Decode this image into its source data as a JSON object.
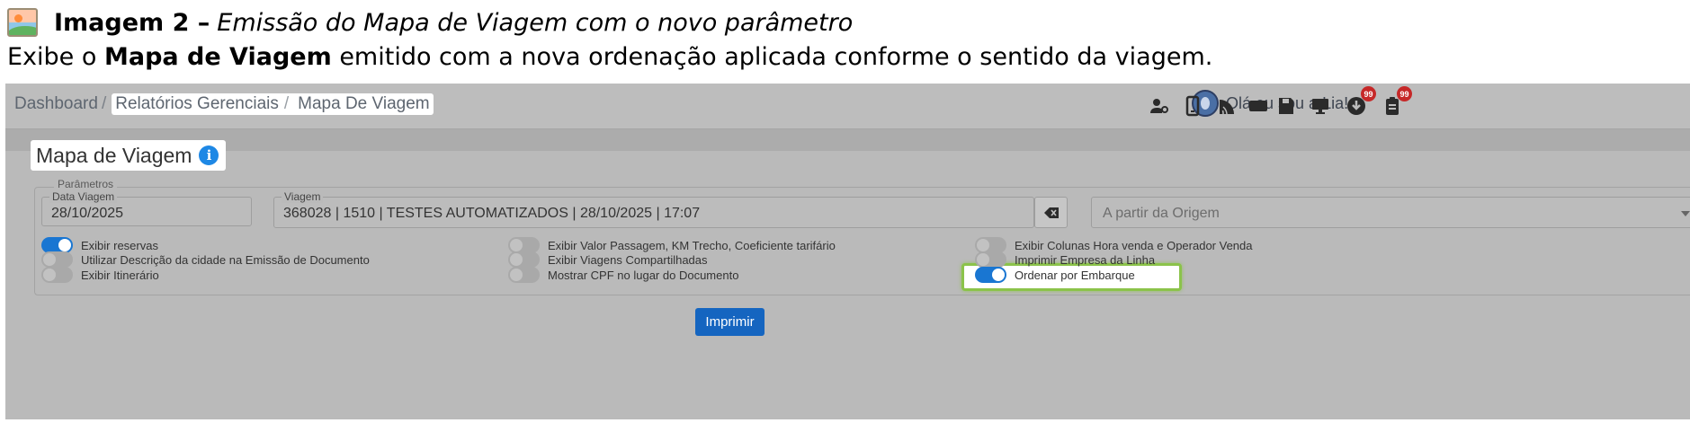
{
  "doc": {
    "caption_label": "Imagem 2 –",
    "caption_text": "Emissão do Mapa de Viagem com o novo parâmetro",
    "desc_before": "Exibe o ",
    "desc_bold": "Mapa de Viagem",
    "desc_after": " emitido com a nova ordenação aplicada conforme o sentido da viagem."
  },
  "topbar": {
    "breadcrumb": {
      "home": "Dashboard",
      "sep1": "/",
      "section": "Relatórios Gerenciais",
      "sep2": "/",
      "current": "Mapa De Viagem"
    },
    "assistant_label": "Olá eu sou a Lia!",
    "icons": [
      "user-settings-icon",
      "mobile-icon",
      "wifi-icon",
      "card-icon",
      "save-icon",
      "monitor-icon",
      "download-icon",
      "clipboard-icon"
    ],
    "badges": {
      "download": "99",
      "clipboard": "99"
    }
  },
  "card": {
    "title": "Mapa de Viagem",
    "info": "i"
  },
  "params": {
    "legend": "Parâmetros",
    "data_viagem": {
      "label": "Data Viagem",
      "value": "28/10/2025"
    },
    "viagem": {
      "label": "Viagem",
      "value": "368028 | 1510 | TESTES AUTOMATIZADOS | 28/10/2025 | 17:07"
    },
    "sentido": {
      "placeholder": "A partir da Origem"
    },
    "toggles": [
      {
        "label": "Exibir reservas",
        "on": true
      },
      {
        "label": "Utilizar Descrição da cidade na Emissão de Documento",
        "on": false
      },
      {
        "label": "Exibir Itinerário",
        "on": false
      },
      {
        "label": "Exibir Valor Passagem, KM Trecho, Coeficiente tarifário",
        "on": false
      },
      {
        "label": "Exibir Viagens Compartilhadas",
        "on": false
      },
      {
        "label": "Mostrar CPF no lugar do Documento",
        "on": false
      },
      {
        "label": "Exibir Colunas Hora venda e Operador Venda",
        "on": false
      },
      {
        "label": "Imprimir Empresa da Linha",
        "on": false
      },
      {
        "label": "Ordenar por Embarque",
        "on": true
      }
    ]
  },
  "actions": {
    "print": "Imprimir"
  },
  "colors": {
    "primary": "#1976d2",
    "highlight": "#8bc34a",
    "badge": "#c62828"
  }
}
